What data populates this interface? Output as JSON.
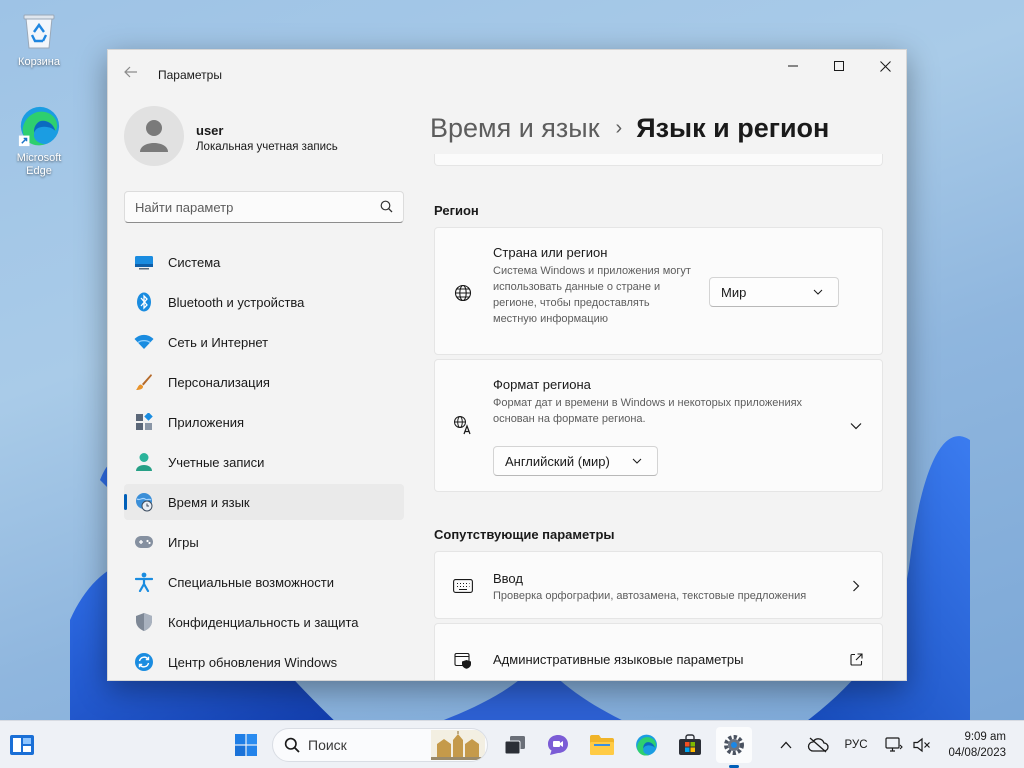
{
  "desktop": {
    "icons": [
      {
        "label": "Корзина"
      },
      {
        "label": "Microsoft Edge"
      }
    ]
  },
  "window": {
    "app_title": "Параметры",
    "profile": {
      "name": "user",
      "account_type": "Локальная учетная запись"
    },
    "search": {
      "placeholder": "Найти параметр"
    },
    "nav": [
      {
        "label": "Система",
        "icon": "display-icon"
      },
      {
        "label": "Bluetooth и устройства",
        "icon": "bluetooth-icon"
      },
      {
        "label": "Сеть и Интернет",
        "icon": "wifi-icon"
      },
      {
        "label": "Персонализация",
        "icon": "brush-icon"
      },
      {
        "label": "Приложения",
        "icon": "apps-icon"
      },
      {
        "label": "Учетные записи",
        "icon": "person-icon"
      },
      {
        "label": "Время и язык",
        "icon": "globe-clock-icon",
        "active": true
      },
      {
        "label": "Игры",
        "icon": "gamepad-icon"
      },
      {
        "label": "Специальные возможности",
        "icon": "accessibility-icon"
      },
      {
        "label": "Конфиденциальность и защита",
        "icon": "shield-icon"
      },
      {
        "label": "Центр обновления Windows",
        "icon": "update-icon"
      }
    ],
    "breadcrumb": {
      "parent": "Время и язык",
      "separator": "›",
      "current": "Язык и регион"
    },
    "region_section": {
      "title": "Регион",
      "country": {
        "title": "Страна или регион",
        "description": "Система Windows и приложения могут использовать данные о стране и регионе, чтобы предоставлять местную информацию",
        "value": "Мир"
      },
      "format": {
        "title": "Формат региона",
        "description": "Формат дат и времени в Windows и некоторых приложениях основан на формате региона.",
        "value": "Английский (мир)"
      }
    },
    "related_section": {
      "title": "Сопутствующие параметры",
      "typing": {
        "title": "Ввод",
        "description": "Проверка орфографии, автозамена, текстовые предложения"
      },
      "admin": {
        "title": "Административные языковые параметры"
      }
    }
  },
  "taskbar": {
    "search_label": "Поиск",
    "language": "РУС",
    "time": "9:09 am",
    "date": "04/08/2023"
  },
  "colors": {
    "accent": "#005fb8",
    "window_bg": "#f3f3f3",
    "card_bg": "#fbfbfb"
  }
}
